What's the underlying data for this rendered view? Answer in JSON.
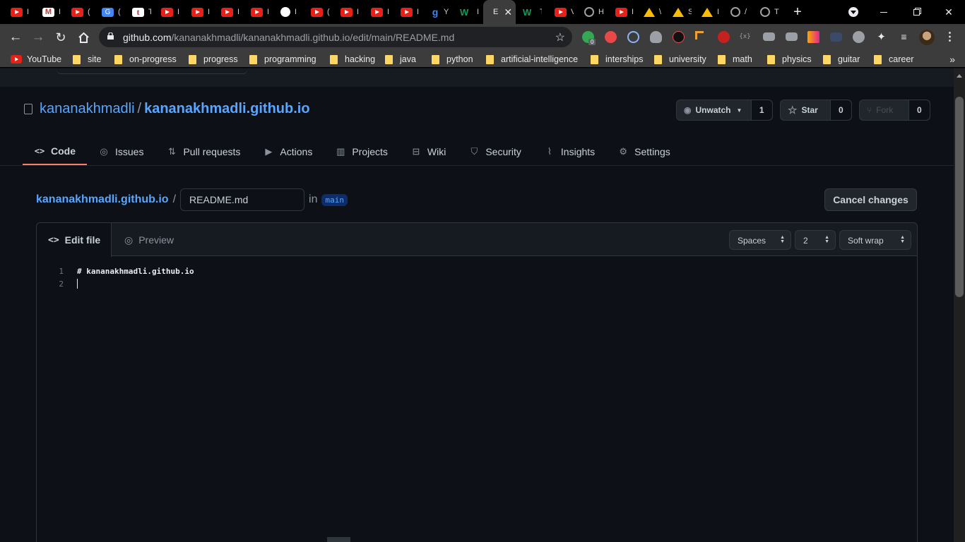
{
  "browser": {
    "tabs": [
      {
        "icon": "youtube",
        "title": "I"
      },
      {
        "icon": "gmail",
        "title": "I"
      },
      {
        "icon": "youtube",
        "title": "("
      },
      {
        "icon": "google-translate",
        "title": "("
      },
      {
        "icon": "tumblr",
        "title": "T"
      },
      {
        "icon": "youtube",
        "title": "I"
      },
      {
        "icon": "youtube",
        "title": "I"
      },
      {
        "icon": "youtube",
        "title": "I"
      },
      {
        "icon": "youtube",
        "title": "I"
      },
      {
        "icon": "box",
        "title": "I"
      },
      {
        "icon": "youtube",
        "title": "("
      },
      {
        "icon": "youtube",
        "title": "I"
      },
      {
        "icon": "youtube",
        "title": "I"
      },
      {
        "icon": "youtube",
        "title": "I"
      },
      {
        "icon": "grammarly",
        "title": "Y"
      },
      {
        "icon": "webflow",
        "title": "I"
      },
      {
        "icon": "github",
        "title": "E",
        "active": true
      },
      {
        "icon": "webflow",
        "title": "T"
      },
      {
        "icon": "youtube",
        "title": "V"
      },
      {
        "icon": "globe",
        "title": "H"
      },
      {
        "icon": "youtube",
        "title": "I"
      },
      {
        "icon": "google-drive",
        "title": "\\"
      },
      {
        "icon": "google-drive",
        "title": "S"
      },
      {
        "icon": "google-drive",
        "title": "I"
      },
      {
        "icon": "globe",
        "title": "/"
      },
      {
        "icon": "globe",
        "title": "T"
      }
    ],
    "new_tab_label": "+",
    "url_host": "github.com",
    "url_path": "/kananakhmadli/kananakhmadli.github.io/edit/main/README.md",
    "extension_badge": "0",
    "bookmarks": [
      {
        "type": "youtube",
        "label": "YouTube"
      },
      {
        "type": "folder",
        "label": "site"
      },
      {
        "type": "folder",
        "label": "on-progress"
      },
      {
        "type": "folder",
        "label": "progress"
      },
      {
        "type": "folder",
        "label": "programming"
      },
      {
        "type": "folder",
        "label": "hacking"
      },
      {
        "type": "folder",
        "label": "java"
      },
      {
        "type": "folder",
        "label": "python"
      },
      {
        "type": "folder",
        "label": "artificial-intelligence"
      },
      {
        "type": "folder",
        "label": "interships"
      },
      {
        "type": "folder",
        "label": "university"
      },
      {
        "type": "folder",
        "label": "math"
      },
      {
        "type": "folder",
        "label": "physics"
      },
      {
        "type": "folder",
        "label": "guitar"
      },
      {
        "type": "folder",
        "label": "career"
      }
    ]
  },
  "repo": {
    "owner": "kananakhmadli",
    "separator": "/",
    "name": "kananakhmadli.github.io",
    "watch_label": "Unwatch",
    "watch_count": "1",
    "star_label": "Star",
    "star_count": "0",
    "fork_label": "Fork",
    "fork_count": "0",
    "nav": [
      {
        "label": "Code",
        "icon": "code-icon",
        "selected": true
      },
      {
        "label": "Issues",
        "icon": "issue-icon"
      },
      {
        "label": "Pull requests",
        "icon": "pull-request-icon"
      },
      {
        "label": "Actions",
        "icon": "play-icon"
      },
      {
        "label": "Projects",
        "icon": "project-icon"
      },
      {
        "label": "Wiki",
        "icon": "book-icon"
      },
      {
        "label": "Security",
        "icon": "shield-icon"
      },
      {
        "label": "Insights",
        "icon": "graph-icon"
      },
      {
        "label": "Settings",
        "icon": "gear-icon"
      }
    ]
  },
  "edit": {
    "breadcrumb_repo": "kananakhmadli.github.io",
    "slash": "/",
    "filename": "README.md",
    "in_label": "in",
    "branch": "main",
    "cancel_label": "Cancel changes",
    "tab_edit": "Edit file",
    "tab_preview": "Preview",
    "indent_mode": "Spaces",
    "indent_size": "2",
    "wrap_mode": "Soft wrap",
    "lines": [
      {
        "num": "1",
        "text": "# kananakhmadli.github.io"
      },
      {
        "num": "2",
        "text": ""
      }
    ]
  },
  "colors": {
    "accent": "#58a6ff",
    "selected_tab_underline": "#f78166",
    "page_bg": "#0d1117"
  }
}
